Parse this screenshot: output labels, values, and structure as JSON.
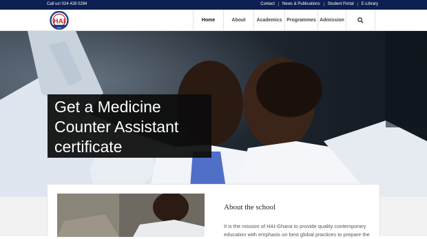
{
  "topbar": {
    "call": "Call us! 024 428 0284",
    "links": [
      "Contact",
      "News & Publications",
      "Student Portal",
      "E-Library"
    ]
  },
  "nav": {
    "items": [
      {
        "label": "Home",
        "active": true
      },
      {
        "label": "About",
        "active": false
      },
      {
        "label": "Academics",
        "active": false
      },
      {
        "label": "Programmes",
        "active": false
      },
      {
        "label": "Admission",
        "active": false
      }
    ],
    "search_icon": "search-icon"
  },
  "logo": {
    "text": "HAI",
    "icon": "school-crest-logo"
  },
  "hero": {
    "headline_lines": [
      "Get a Medicine",
      "Counter Assistant",
      "certificate"
    ]
  },
  "about": {
    "title": "About the school",
    "text": "It is the mission of HAI-Ghana to provide quality contemporary education with emphasis on best global practices to prepare the"
  },
  "colors": {
    "topbar": "#0d1f52",
    "headline_box": "#0c0c0c",
    "page_bg": "#f2f2f2"
  }
}
